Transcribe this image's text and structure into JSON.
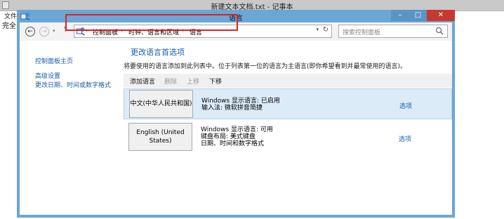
{
  "notepad": {
    "title": "新建文本文档.txt - 记事本",
    "menu_file": "文件",
    "text": "完全"
  },
  "window": {
    "title": "语言",
    "minimize": "–",
    "maximize": "□",
    "close": "✕"
  },
  "nav": {
    "back": "←",
    "forward": "→",
    "history": "▾",
    "up": "↑",
    "breadcrumbs": [
      "控制面板",
      "时钟、语言和区域",
      "语言"
    ],
    "crumb_sep": "▸",
    "dropdown": "▾",
    "refresh": "↻",
    "search_placeholder": "搜索控制面板"
  },
  "sidebar": {
    "items": [
      {
        "label": "控制面板主页"
      },
      {
        "label": "高级设置"
      },
      {
        "label": "更改日期、时间或数字格式"
      }
    ]
  },
  "main": {
    "heading": "更改语言首选项",
    "description": "将要使用的语言添加到此列表中。位于列表第一位的语言为主语言(即你希望看到并最常使用的语言)。",
    "toolbar": {
      "add": "添加语言",
      "remove": "删除",
      "move_up": "上移",
      "move_down": "下移"
    },
    "languages": [
      {
        "name": "中文(中华人民共和国)",
        "lines": [
          "Windows 显示语言: 已启用",
          "输入法: 微软拼音简捷"
        ],
        "options": "选项"
      },
      {
        "name": "English (United States)",
        "lines": [
          "Windows 显示语言: 可用",
          "键盘布局: 美式键盘",
          "日期、时间和数字格式"
        ],
        "options": "选项"
      }
    ]
  },
  "colors": {
    "titlebar_blue": "#6aa6d6",
    "close_red": "#c7382f",
    "link_blue": "#1a5ea8",
    "selected_row": "#dcebf8",
    "highlight_red": "#e02020"
  }
}
